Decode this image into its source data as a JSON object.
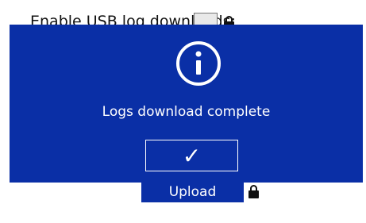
{
  "settings": {
    "usb_log_label": "Enable USB log downloads:",
    "upload_settings_label": "Upload settings"
  },
  "dialog": {
    "message": "Logs download complete",
    "confirm_symbol": "✓",
    "icon": "info-icon"
  },
  "colors": {
    "dialog_background": "#0a2fa6",
    "button_background": "#0a2fa6",
    "text_light": "#ffffff",
    "text_dark": "#111111"
  }
}
